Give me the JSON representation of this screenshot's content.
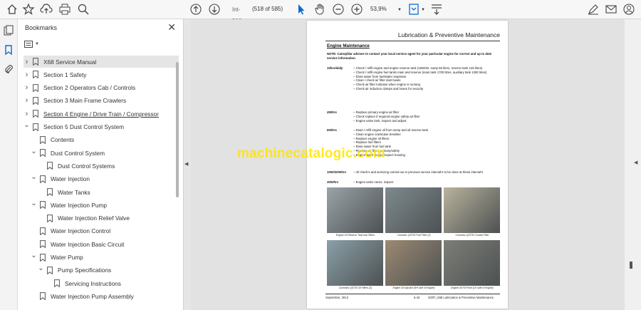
{
  "toolbar": {
    "page_label": "Int-518",
    "page_count": "(518 of 585)",
    "zoom": "53,9%"
  },
  "panel": {
    "title": "Bookmarks"
  },
  "bookmarks": [
    {
      "label": "X68 Service Manual",
      "state": "collapsed",
      "selected": true
    },
    {
      "label": "Section 1 Safety",
      "state": "collapsed"
    },
    {
      "label": "Section 2 Operators Cab / Controls",
      "state": "collapsed"
    },
    {
      "label": "Section 3 Main Frame Crawlers",
      "state": "collapsed"
    },
    {
      "label": "Section 4 Engine / Drive Train / Compressor",
      "state": "collapsed"
    },
    {
      "label": "Section 5 Dust Control System",
      "state": "expanded"
    },
    {
      "label": "Contents",
      "state": "leaf"
    },
    {
      "label": "Dust Control System",
      "state": "expanded"
    },
    {
      "label": "Dust Control Systems",
      "state": "leaf"
    },
    {
      "label": "Water Injection",
      "state": "expanded"
    },
    {
      "label": "Water Tanks",
      "state": "leaf"
    },
    {
      "label": "Water Injection Pump",
      "state": "expanded"
    },
    {
      "label": "Water Injection Relief Valve",
      "state": "leaf"
    },
    {
      "label": "Water Injection Control",
      "state": "leaf"
    },
    {
      "label": "Water Injection Basic Circuit",
      "state": "leaf"
    },
    {
      "label": "Water Pump",
      "state": "expanded"
    },
    {
      "label": "Pump Specifications",
      "state": "expanded"
    },
    {
      "label": "Servicing Instructions",
      "state": "leaf"
    },
    {
      "label": "Water Injection Pump Assembly",
      "state": "leaf"
    }
  ],
  "document": {
    "header": "Lubrication & Preventive Maintenance",
    "section_title": "Engine Maintenance",
    "note": "NOTE: Caterpillar advises to contact your local service agent for your particular engine for correct and up to date service information.",
    "schedule": [
      {
        "interval": "10hrs/daily",
        "tasks": [
          "– Check / refill engine and engine reserve tank (15W/40, sump 65 litres, reserve tank 125 litres)",
          "– Check / refill engine fuel tanks main and reserve (main tank 1700 litres, auxiliary tank 1300 litres)",
          "– Drain water from fuel/water separator",
          "– Clean / check air filter dust bowls",
          "– Check air filter indicator when engine is running",
          "– Check air induction clamps and hoses for security"
        ]
      },
      {
        "interval": "250hrs",
        "tasks": [
          "– Replace primary engine air filter",
          "– Check replace if required engine safety air filter",
          "– Engine valve lash, inspect and adjust"
        ]
      },
      {
        "interval": "500hrs",
        "tasks": [
          "– Drain / refill engine oil from sump and oil reserve tank",
          "– Clean engine crankcase breather",
          "– Replace engine oil filters",
          "– Replace fuel filters",
          "– Drain water from fuel tank",
          "– Replace air filters primary/safety",
          "– Engine water pump, inspect housing"
        ]
      },
      {
        "interval": "1000/2000hrs",
        "tasks": [
          "– All check's and servicing carried out in previous service interval's to be done at these interval's"
        ]
      },
      {
        "interval": "3000hrs",
        "tasks": [
          "– Engine valve rotors, inspect"
        ]
      }
    ],
    "photo_captions": [
      "Engine Oil Reserve Tank and Filters",
      "Cummins QST30 Fuel Filter (2)",
      "Cummins QST30 Coolant Filter",
      "Cummins QST30 Oil Filters (3)",
      "Engine Oil Dipstick (RH side of Engine)",
      "Engine Oil Fill Point (LH side of Engine)"
    ],
    "footer_left": "September, 2013",
    "footer_mid": "5-43",
    "footer_right": "20/07_X68 Lubrication & Preventive Maintenance"
  },
  "watermark": "machinecatalogic.com",
  "colors": {
    "accent": "#0b6bd0",
    "watermark": "#ffe500"
  }
}
